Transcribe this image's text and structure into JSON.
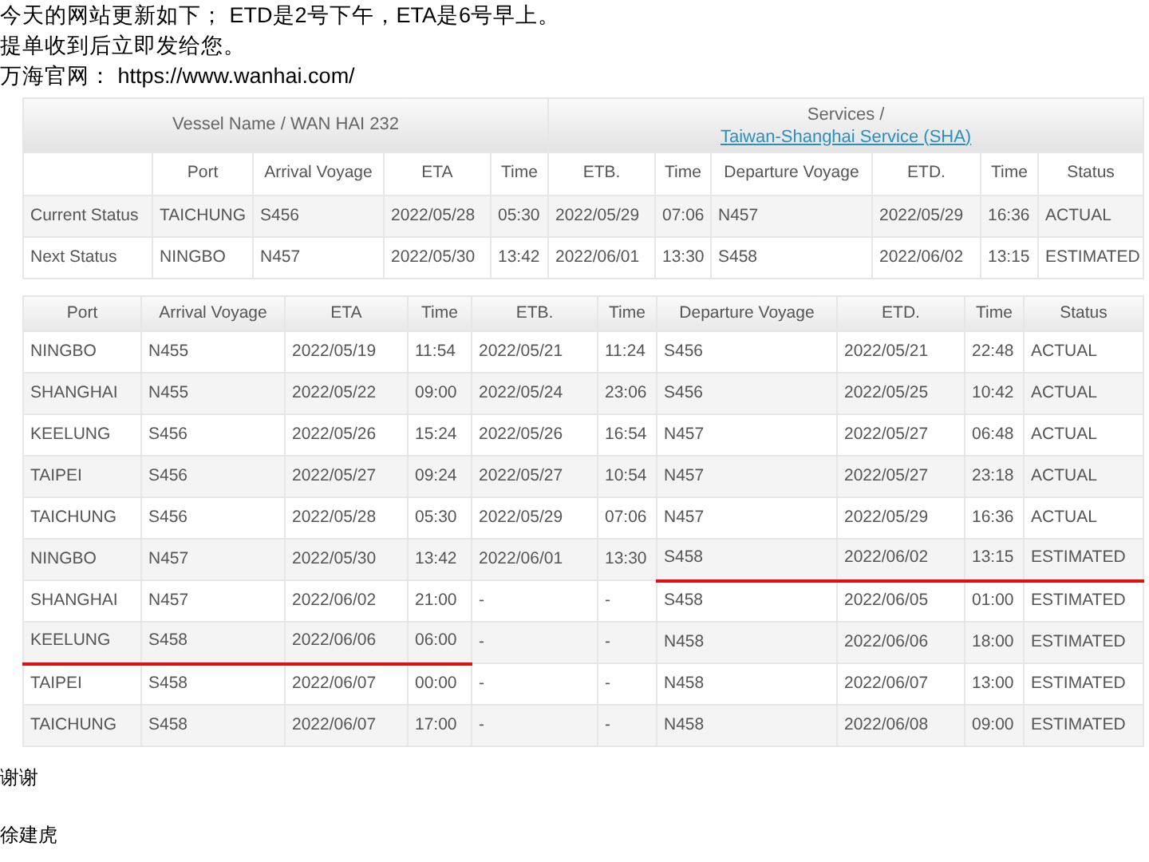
{
  "message": {
    "lines": [
      "今天的网站更新如下； ETD是2号下午，ETA是6号早上。",
      "提单收到后立即发给您。",
      "万海官网： https://www.wanhai.com/"
    ]
  },
  "vessel_table": {
    "vessel_heading": "Vessel Name / WAN HAI 232",
    "services_label": "Services /",
    "service_link": "Taiwan-Shanghai Service (SHA)",
    "columns": [
      "Port",
      "Arrival Voyage",
      "ETA",
      "Time",
      "ETB.",
      "Time",
      "Departure Voyage",
      "ETD.",
      "Time",
      "Status"
    ],
    "rows": [
      {
        "label": "Current Status",
        "cells": [
          "TAICHUNG",
          "S456",
          "2022/05/28",
          "05:30",
          "2022/05/29",
          "07:06",
          "N457",
          "2022/05/29",
          "16:36",
          "ACTUAL"
        ]
      },
      {
        "label": "Next Status",
        "cells": [
          "NINGBO",
          "N457",
          "2022/05/30",
          "13:42",
          "2022/06/01",
          "13:30",
          "S458",
          "2022/06/02",
          "13:15",
          "ESTIMATED"
        ]
      }
    ]
  },
  "schedule_table": {
    "columns": [
      "Port",
      "Arrival Voyage",
      "ETA",
      "Time",
      "ETB.",
      "Time",
      "Departure Voyage",
      "ETD.",
      "Time",
      "Status"
    ],
    "rows": [
      {
        "arrival_underlined": false,
        "departure_underlined": false,
        "cells": [
          "NINGBO",
          "N455",
          "2022/05/19",
          "11:54",
          "2022/05/21",
          "11:24",
          "S456",
          "2022/05/21",
          "22:48",
          "ACTUAL"
        ]
      },
      {
        "arrival_underlined": false,
        "departure_underlined": false,
        "cells": [
          "SHANGHAI",
          "N455",
          "2022/05/22",
          "09:00",
          "2022/05/24",
          "23:06",
          "S456",
          "2022/05/25",
          "10:42",
          "ACTUAL"
        ]
      },
      {
        "arrival_underlined": false,
        "departure_underlined": false,
        "cells": [
          "KEELUNG",
          "S456",
          "2022/05/26",
          "15:24",
          "2022/05/26",
          "16:54",
          "N457",
          "2022/05/27",
          "06:48",
          "ACTUAL"
        ]
      },
      {
        "arrival_underlined": false,
        "departure_underlined": false,
        "cells": [
          "TAIPEI",
          "S456",
          "2022/05/27",
          "09:24",
          "2022/05/27",
          "10:54",
          "N457",
          "2022/05/27",
          "23:18",
          "ACTUAL"
        ]
      },
      {
        "arrival_underlined": false,
        "departure_underlined": false,
        "cells": [
          "TAICHUNG",
          "S456",
          "2022/05/28",
          "05:30",
          "2022/05/29",
          "07:06",
          "N457",
          "2022/05/29",
          "16:36",
          "ACTUAL"
        ]
      },
      {
        "arrival_underlined": false,
        "departure_underlined": true,
        "cells": [
          "NINGBO",
          "N457",
          "2022/05/30",
          "13:42",
          "2022/06/01",
          "13:30",
          "S458",
          "2022/06/02",
          "13:15",
          "ESTIMATED"
        ]
      },
      {
        "arrival_underlined": false,
        "departure_underlined": false,
        "cells": [
          "SHANGHAI",
          "N457",
          "2022/06/02",
          "21:00",
          "-",
          "-",
          "S458",
          "2022/06/05",
          "01:00",
          "ESTIMATED"
        ]
      },
      {
        "arrival_underlined": true,
        "departure_underlined": false,
        "cells": [
          "KEELUNG",
          "S458",
          "2022/06/06",
          "06:00",
          "-",
          "-",
          "N458",
          "2022/06/06",
          "18:00",
          "ESTIMATED"
        ]
      },
      {
        "arrival_underlined": false,
        "departure_underlined": false,
        "cells": [
          "TAIPEI",
          "S458",
          "2022/06/07",
          "00:00",
          "-",
          "-",
          "N458",
          "2022/06/07",
          "13:00",
          "ESTIMATED"
        ]
      },
      {
        "arrival_underlined": false,
        "departure_underlined": false,
        "cells": [
          "TAICHUNG",
          "S458",
          "2022/06/07",
          "17:00",
          "-",
          "-",
          "N458",
          "2022/06/08",
          "09:00",
          "ESTIMATED"
        ]
      }
    ]
  },
  "closing": [
    "谢谢",
    "徐建虎"
  ]
}
